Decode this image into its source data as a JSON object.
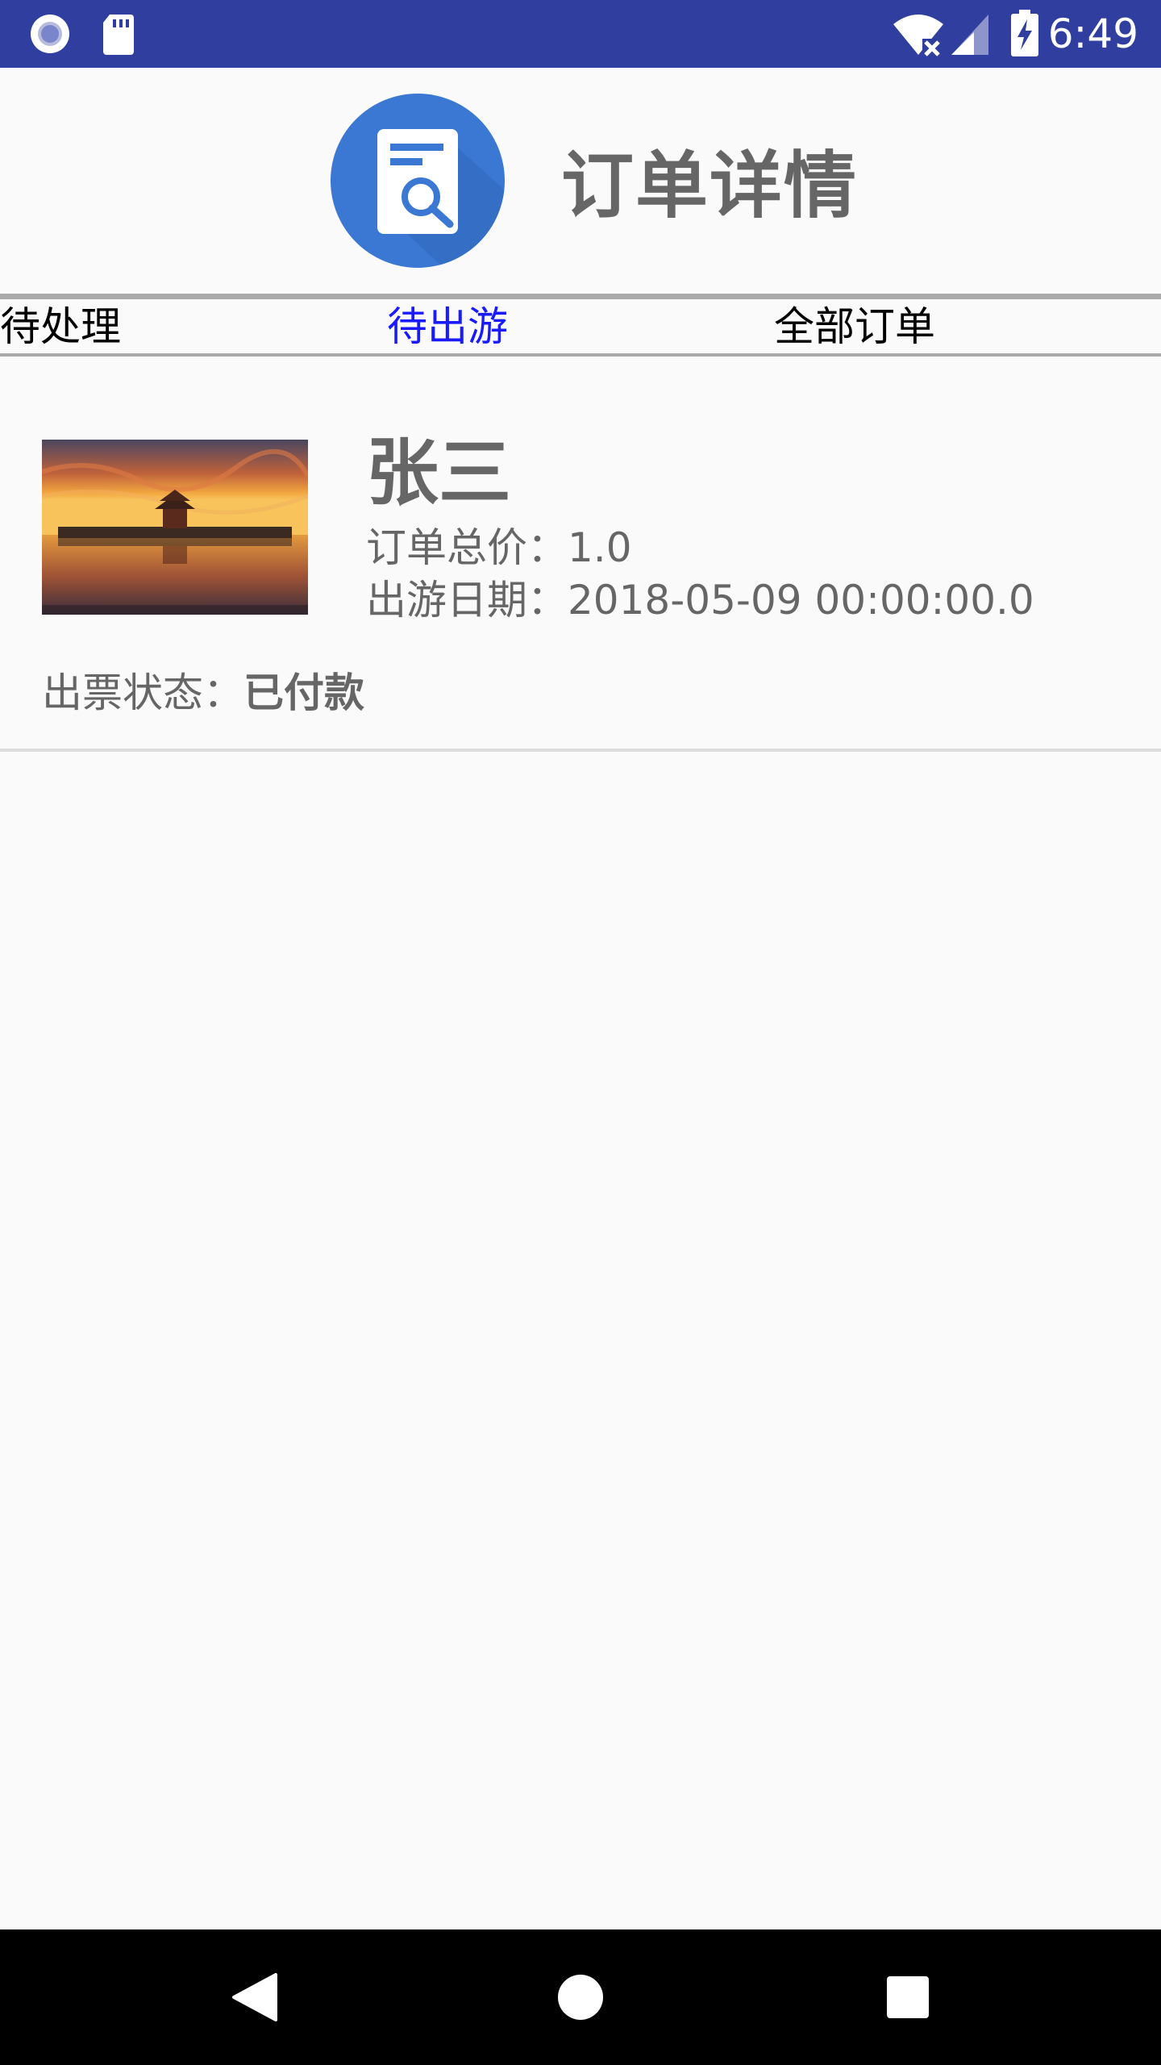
{
  "status_bar": {
    "time": "6:49",
    "left_icons": [
      "record-icon",
      "sd-card-icon"
    ],
    "right_icons": [
      "wifi-off-icon",
      "signal-icon",
      "battery-charging-icon"
    ],
    "color": "#303f9f"
  },
  "header": {
    "title": "订单详情",
    "logo_icon": "document-search-icon",
    "logo_color": "#3a78d4"
  },
  "tabs": [
    {
      "label": "待处理",
      "active": false
    },
    {
      "label": "待出游",
      "active": true
    },
    {
      "label": "全部订单",
      "active": false
    }
  ],
  "order": {
    "thumbnail_icon": "forbidden-city-sunset-photo",
    "name": "张三",
    "total_price_label": "订单总价：",
    "total_price": "1.0",
    "travel_date_label": "出游日期：",
    "travel_date": "2018-05-09 00:00:00.0",
    "ticket_status_label": "出票状态：",
    "ticket_status": "已付款"
  },
  "nav_bar": {
    "buttons": [
      "back-icon",
      "home-icon",
      "recents-icon"
    ]
  }
}
